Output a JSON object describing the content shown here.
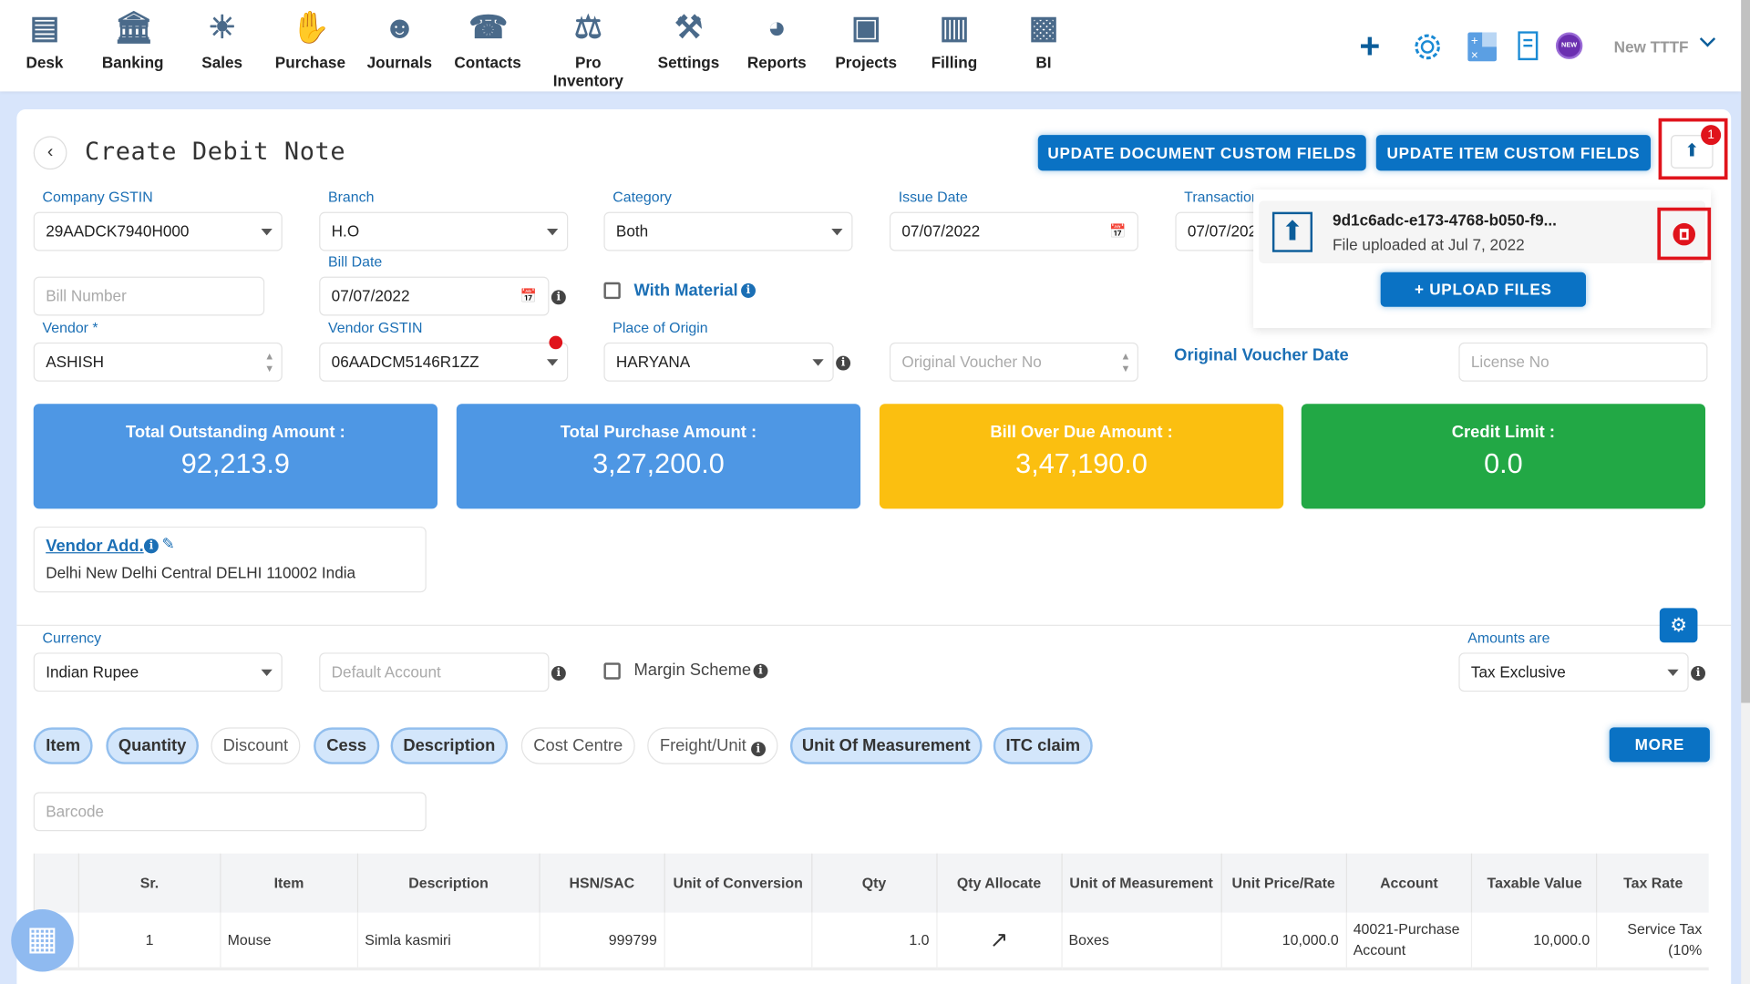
{
  "nav": {
    "items": [
      {
        "label": "Desk",
        "icon": "desk-icon"
      },
      {
        "label": "Banking",
        "icon": "bank-icon"
      },
      {
        "label": "Sales",
        "icon": "sales-icon"
      },
      {
        "label": "Purchase",
        "icon": "purchase-icon"
      },
      {
        "label": "Journals",
        "icon": "journals-icon"
      },
      {
        "label": "Contacts",
        "icon": "contacts-icon"
      },
      {
        "label": "Pro Inventory",
        "icon": "inventory-icon"
      },
      {
        "label": "Settings",
        "icon": "settings-icon"
      },
      {
        "label": "Reports",
        "icon": "reports-icon"
      },
      {
        "label": "Projects",
        "icon": "projects-icon"
      },
      {
        "label": "Filling",
        "icon": "filling-icon"
      },
      {
        "label": "BI",
        "icon": "bi-icon"
      }
    ],
    "company": "New TTTF",
    "new_badge": "NEW"
  },
  "page": {
    "title": "Create Debit Note",
    "update_doc_fields": "UPDATE DOCUMENT CUSTOM FIELDS",
    "update_item_fields": "UPDATE ITEM CUSTOM FIELDS",
    "upload_count": "1"
  },
  "upload_popup": {
    "file_name": "9d1c6adc-e173-4768-b050-f9...",
    "file_status": "File uploaded at Jul 7, 2022",
    "upload_button": "+ UPLOAD FILES"
  },
  "form": {
    "company_gstin": {
      "label": "Company GSTIN",
      "value": "29AADCK7940H000"
    },
    "branch": {
      "label": "Branch",
      "value": "H.O"
    },
    "category": {
      "label": "Category",
      "value": "Both"
    },
    "issue_date": {
      "label": "Issue Date",
      "value": "07/07/2022"
    },
    "transaction": {
      "label": "Transaction",
      "value": "07/07/2022"
    },
    "bill_number": {
      "placeholder": "Bill Number"
    },
    "bill_date": {
      "label": "Bill Date",
      "value": "07/07/2022"
    },
    "with_material": "With Material",
    "vendor": {
      "label": "Vendor *",
      "value": "ASHISH"
    },
    "vendor_gstin": {
      "label": "Vendor GSTIN",
      "value": "06AADCM5146R1ZZ"
    },
    "place_of_origin": {
      "label": "Place of Origin",
      "value": "HARYANA"
    },
    "original_voucher_no": {
      "placeholder": "Original Voucher No"
    },
    "original_voucher_date": "Original Voucher Date",
    "license_no": {
      "placeholder": "License No"
    },
    "currency": {
      "label": "Currency",
      "value": "Indian Rupee"
    },
    "default_account": {
      "placeholder": "Default Account"
    },
    "margin_scheme": "Margin Scheme",
    "amounts_are": {
      "label": "Amounts are",
      "value": "Tax Exclusive"
    },
    "barcode": {
      "placeholder": "Barcode"
    }
  },
  "stats": [
    {
      "title": "Total Outstanding Amount :",
      "value": "92,213.9",
      "color": "#4e97e4"
    },
    {
      "title": "Total Purchase Amount :",
      "value": "3,27,200.0",
      "color": "#4e97e4"
    },
    {
      "title": "Bill Over Due Amount :",
      "value": "3,47,190.0",
      "color": "#fbbf10"
    },
    {
      "title": "Credit Limit :",
      "value": "0.0",
      "color": "#22a845"
    }
  ],
  "vendor_address": {
    "label": "Vendor Add.",
    "value": "Delhi New Delhi Central DELHI 110002 India"
  },
  "chips": [
    {
      "label": "Item",
      "on": true
    },
    {
      "label": "Quantity",
      "on": true
    },
    {
      "label": "Discount",
      "on": false
    },
    {
      "label": "Cess",
      "on": true
    },
    {
      "label": "Description",
      "on": true
    },
    {
      "label": "Cost Centre",
      "on": false
    },
    {
      "label": "Freight/Unit",
      "on": false
    },
    {
      "label": "Unit Of Measurement",
      "on": true
    },
    {
      "label": "ITC claim",
      "on": true
    }
  ],
  "more_button": "MORE",
  "table": {
    "headers": [
      "",
      "Sr.",
      "Item",
      "Description",
      "HSN/SAC",
      "Unit of Conversion",
      "Qty",
      "Qty Allocate",
      "Unit of Measurement",
      "Unit Price/Rate",
      "Account",
      "Taxable Value",
      "Tax Rate"
    ],
    "rows": [
      [
        "",
        "1",
        "Mouse",
        "Simla kasmiri",
        "999799",
        "",
        "1.0",
        "",
        "Boxes",
        "10,000.0",
        "40021-Purchase Account",
        "10,000.0",
        "Service Tax (10%"
      ]
    ]
  }
}
